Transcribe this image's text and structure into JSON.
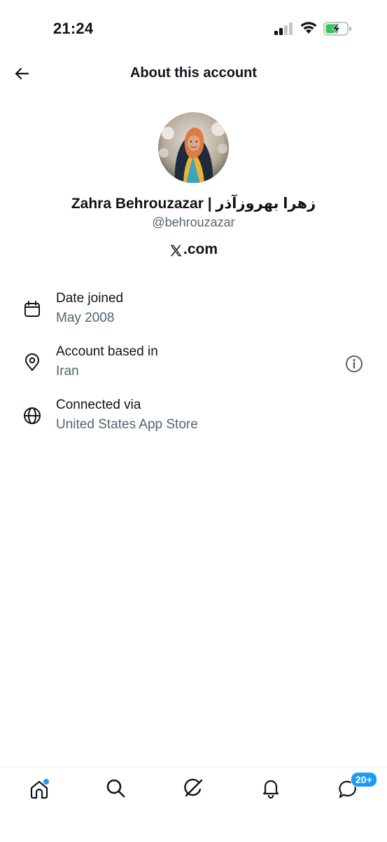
{
  "status_bar": {
    "time": "21:24"
  },
  "header": {
    "title": "About this account"
  },
  "profile": {
    "display_name": "Zahra Behrouzazar | زهرا بهروزآذر",
    "handle": "@behrouzazar",
    "site": ".com"
  },
  "rows": [
    {
      "label": "Date joined",
      "value": "May 2008",
      "icon": "calendar-icon"
    },
    {
      "label": "Account based in",
      "value": "Iran",
      "icon": "location-pin-icon",
      "trailing_icon": "info-icon"
    },
    {
      "label": "Connected via",
      "value": "United States App Store",
      "icon": "globe-icon"
    }
  ],
  "tab_bar": {
    "items": [
      "home",
      "search",
      "grok",
      "notifications",
      "messages"
    ],
    "messages_badge": "20+"
  },
  "colors": {
    "text_primary": "#0f1419",
    "text_secondary": "#536471",
    "accent": "#1d9bf0",
    "battery_green": "#34c759"
  }
}
